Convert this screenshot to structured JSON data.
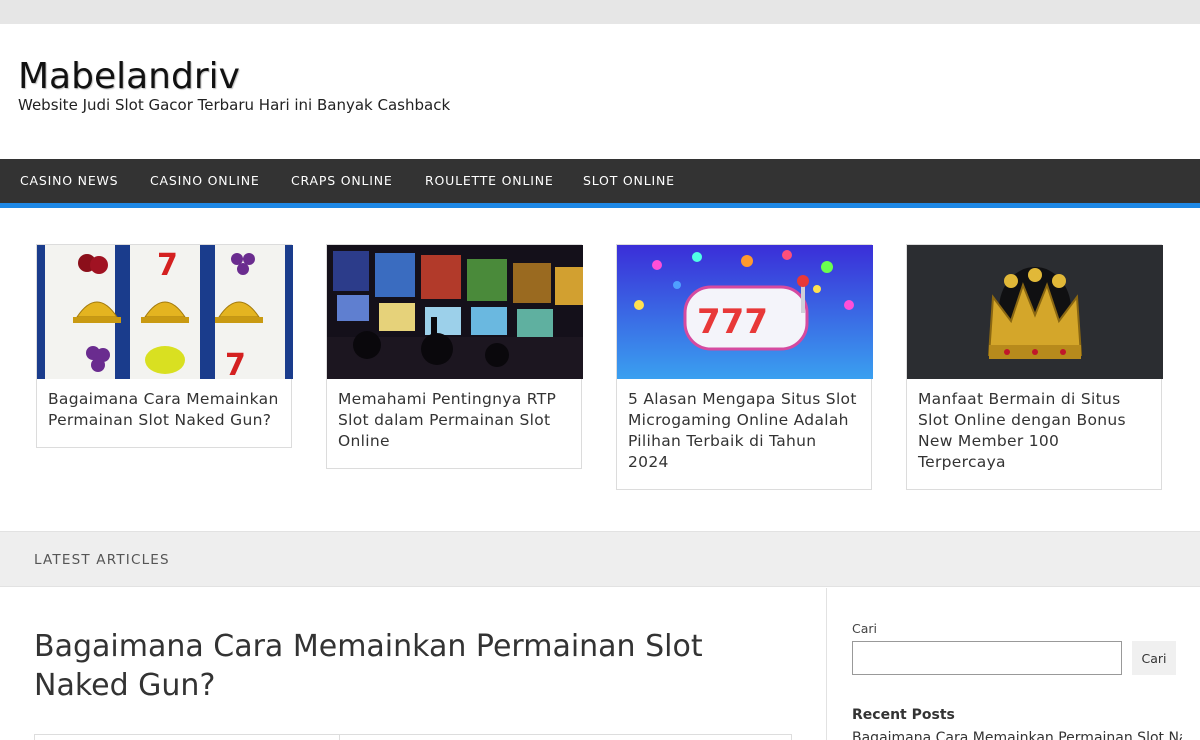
{
  "site": {
    "title": "Mabelandriv",
    "tagline": "Website Judi Slot Gacor Terbaru Hari ini Banyak Cashback"
  },
  "nav": {
    "items": [
      {
        "label": "CASINO NEWS"
      },
      {
        "label": "CASINO ONLINE"
      },
      {
        "label": "CRAPS ONLINE"
      },
      {
        "label": "ROULETTE ONLINE"
      },
      {
        "label": "SLOT ONLINE"
      }
    ]
  },
  "featured": [
    {
      "title": "Bagaimana Cara Memainkan Permainan Slot Naked Gun?",
      "image": "slot-machine-reels-image"
    },
    {
      "title": "Memahami Pentingnya RTP Slot dalam Permainan Slot Online",
      "image": "casino-slot-machines-photo"
    },
    {
      "title": "5 Alasan Mengapa Situs Slot Microgaming Online Adalah Pilihan Terbaik di Tahun 2024",
      "image": "777-slot-reels-image"
    },
    {
      "title": "Manfaat Bermain di Situs Slot Online dengan Bonus New Member 100 Terpercaya",
      "image": "gold-crown-image"
    }
  ],
  "latest": {
    "label": "LATEST ARTICLES"
  },
  "article": {
    "title": "Bagaimana Cara Memainkan Permainan Slot Naked Gun?"
  },
  "sidebar": {
    "search_label": "Cari",
    "search_value": "",
    "search_button": "Cari",
    "recent_heading": "Recent Posts",
    "recent_posts": [
      "Bagaimana Cara Memainkan Permainan Slot Naked Gun?"
    ]
  },
  "colors": {
    "nav_bg": "#333333",
    "nav_accent": "#1e88e5",
    "topbar": "#e6e6e6"
  }
}
